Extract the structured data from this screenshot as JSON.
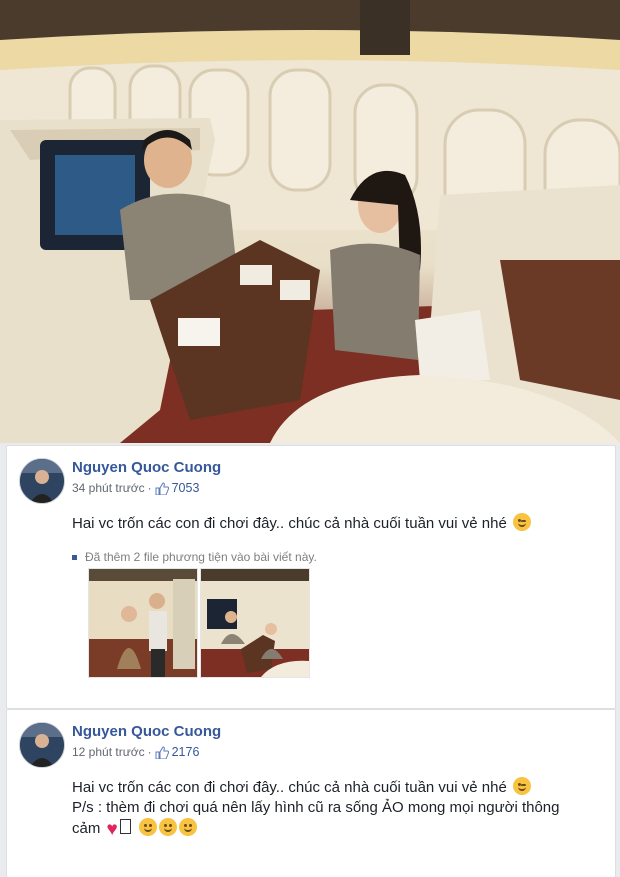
{
  "photo": {
    "alt_name": "couple in airplane first class cabin"
  },
  "posts": [
    {
      "author": "Nguyen Quoc Cuong",
      "time": "34 phút trước",
      "separator": "·",
      "likes": "7053",
      "text": "Hai vc trốn các con đi chơi đây.. chúc cả nhà cuối tuần vui vẻ nhé",
      "emoji": "wink-emoji",
      "attachment_note": "Đã thêm 2 file phương tiện vào bài viết này."
    },
    {
      "author": "Nguyen Quoc Cuong",
      "time": "12 phút trước",
      "separator": "·",
      "likes": "2176",
      "text": "Hai vc trốn các con đi chơi đây.. chúc cả nhà cuối tuần vui vẻ nhé",
      "text2": "P/s : thèm đi chơi quá nên lấy hình cũ ra sống ẢO mong mọi người thông",
      "text3": "cảm"
    }
  ],
  "colors": {
    "author_blue": "#365899",
    "feed_bg": "#e9ebee",
    "text": "#1d2129",
    "meta": "#616770"
  }
}
